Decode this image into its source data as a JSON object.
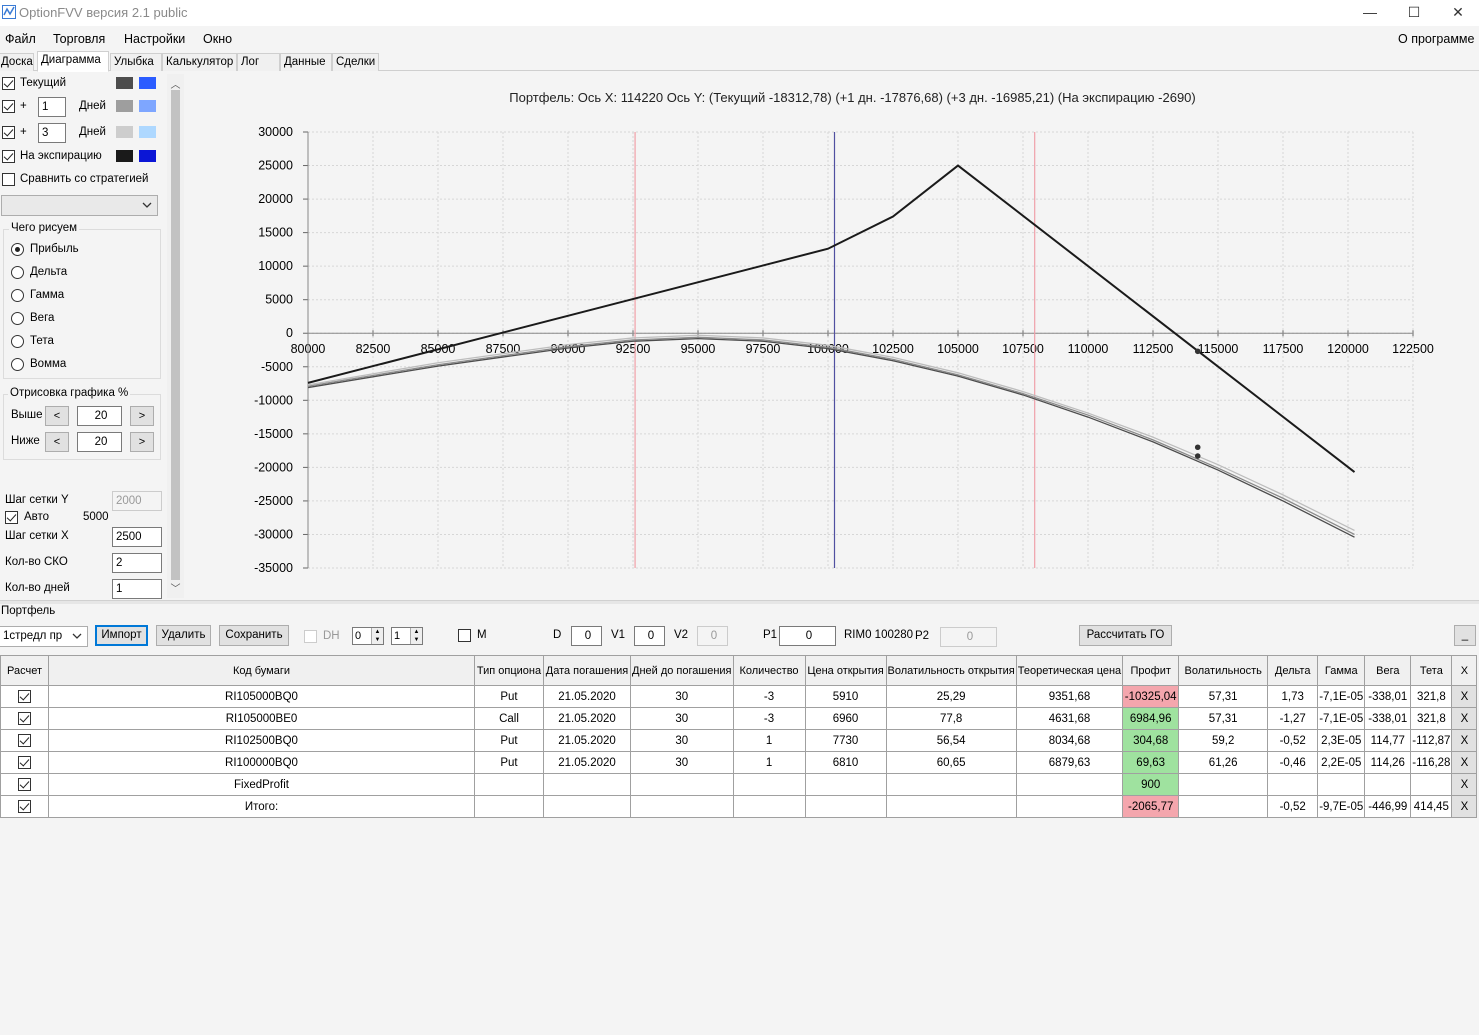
{
  "window": {
    "title": "OptionFVV версия 2.1 public",
    "min": "—",
    "max": "☐",
    "close": "✕"
  },
  "menu": {
    "file": "Файл",
    "trade": "Торговля",
    "settings": "Настройки",
    "window": "Окно",
    "about": "О программе"
  },
  "tabs": [
    "Доска",
    "Диаграмма",
    "Улыбка",
    "Калькулятор",
    "Лог",
    "Данные",
    "Сделки"
  ],
  "left": {
    "current": "Текущий",
    "plus": "+",
    "days1": "1",
    "days3": "3",
    "days_label": "Дней",
    "expiry": "На экспирацию",
    "compare": "Сравнить со стратегией",
    "draw_group": "Чего рисуем",
    "radios": [
      "Прибыль",
      "Дельта",
      "Гамма",
      "Вега",
      "Тета",
      "Вомма"
    ],
    "render_group": "Отрисовка графика %",
    "above": "Выше",
    "below": "Ниже",
    "above_val": "20",
    "below_val": "20",
    "lt": "<",
    "gt": ">",
    "grid_y": "Шаг сетки Y",
    "grid_y_val": "2000",
    "auto": "Авто",
    "auto_val": "5000",
    "grid_x": "Шаг сетки X",
    "grid_x_val": "2500",
    "sko": "Кол-во СКО",
    "sko_val": "2",
    "days_count": "Кол-во дней",
    "days_count_val": "1",
    "colors": {
      "current": [
        "#4d4d4d",
        "#2b5cff"
      ],
      "d1": [
        "#9e9e9e",
        "#7ea6ff"
      ],
      "d3": [
        "#cdcdcd",
        "#aed8ff"
      ],
      "expiry": [
        "#1a1a1a",
        "#0b16d6"
      ]
    }
  },
  "chart_data": {
    "type": "line",
    "title": "Портфель: Ось X: 114220 Ось Y: (Текущий -18312,78) (+1 дн. -17876,68) (+3 дн. -16985,21) (На экспирацию -2690)",
    "xlim": [
      80000,
      122500
    ],
    "ylim": [
      -35000,
      30000
    ],
    "xticks": [
      80000,
      82500,
      85000,
      87500,
      90000,
      92500,
      95000,
      97500,
      100000,
      102500,
      105000,
      107500,
      110000,
      112500,
      115000,
      117500,
      120000,
      122500
    ],
    "yticks": [
      30000,
      25000,
      20000,
      15000,
      10000,
      5000,
      0,
      -5000,
      -10000,
      -15000,
      -20000,
      -25000,
      -30000,
      -35000
    ],
    "vlines": [
      {
        "x": 92580,
        "color": "#f0a0a8"
      },
      {
        "x": 100250,
        "color": "#5050a0"
      },
      {
        "x": 107950,
        "color": "#f0a0a8"
      }
    ],
    "series": [
      {
        "x": [
          80000,
          100000,
          102500,
          105000,
          120250
        ],
        "y": [
          -7400,
          12600,
          17400,
          25000,
          -20700
        ],
        "color": "#1a1a1a",
        "width": 2
      },
      {
        "x": [
          80000,
          85000,
          90000,
          92500,
          95000,
          97500,
          100000,
          102500,
          105000,
          107500,
          110000,
          112500,
          115000,
          117500,
          120250
        ],
        "y": [
          -7700,
          -4400,
          -1700,
          -700,
          -300,
          -700,
          -1800,
          -3600,
          -5900,
          -8700,
          -11900,
          -15500,
          -19600,
          -24100,
          -29400
        ],
        "color": "#bdbdbd",
        "width": 1.3
      },
      {
        "x": [
          80000,
          85000,
          90000,
          92500,
          95000,
          97500,
          100000,
          102500,
          105000,
          107500,
          110000,
          112500,
          115000,
          117500,
          120250
        ],
        "y": [
          -7900,
          -4700,
          -2000,
          -1000,
          -600,
          -1000,
          -2100,
          -3900,
          -6200,
          -9000,
          -12200,
          -15900,
          -20100,
          -24600,
          -30000
        ],
        "color": "#8a8a8a",
        "width": 1.3
      },
      {
        "x": [
          80000,
          85000,
          90000,
          92500,
          95000,
          97500,
          100000,
          102500,
          105000,
          107500,
          110000,
          112500,
          115000,
          117500,
          120250
        ],
        "y": [
          -8100,
          -4900,
          -2200,
          -1200,
          -800,
          -1200,
          -2300,
          -4100,
          -6400,
          -9200,
          -12500,
          -16200,
          -20400,
          -25000,
          -30400
        ],
        "color": "#4d4d4d",
        "width": 1.3
      }
    ],
    "markers": [
      {
        "x": 114220,
        "y": -2690
      },
      {
        "x": 114220,
        "y": -17000
      },
      {
        "x": 114220,
        "y": -18312
      }
    ]
  },
  "portfolio": {
    "label": "Портфель",
    "strategy": "1стредл пр",
    "import": "Импорт",
    "delete": "Удалить",
    "save": "Сохранить",
    "dh": "DH",
    "spin1": "0",
    "spin2": "1",
    "m": "M",
    "d": "D",
    "d_val": "0",
    "v1": "V1",
    "v1_val": "0",
    "v2": "V2",
    "v2_val": "0",
    "p1": "P1",
    "p1_val": "0",
    "rim": "RIM0 100280",
    "p2": "P2",
    "p2_val": "0",
    "calc_go": "Рассчитать ГО",
    "collapse": "_"
  },
  "table": {
    "headers": [
      "Расчет",
      "Код бумаги",
      "Тип опциона",
      "Дата погашения",
      "Дней до погашения",
      "Количество",
      "Цена открытия",
      "Волатильность открытия",
      "Теоретическая цена",
      "Профит",
      "Волатильность",
      "Дельта",
      "Гамма",
      "Вега",
      "Тета",
      "X"
    ],
    "rows": [
      [
        "RI105000BQ0",
        "Put",
        "21.05.2020",
        "30",
        "-3",
        "5910",
        "25,29",
        "9351,68",
        "-10325,04",
        "57,31",
        "1,73",
        "-7,1E-05",
        "-338,01",
        "321,8",
        "X"
      ],
      [
        "RI105000BE0",
        "Call",
        "21.05.2020",
        "30",
        "-3",
        "6960",
        "77,8",
        "4631,68",
        "6984,96",
        "57,31",
        "-1,27",
        "-7,1E-05",
        "-338,01",
        "321,8",
        "X"
      ],
      [
        "RI102500BQ0",
        "Put",
        "21.05.2020",
        "30",
        "1",
        "7730",
        "56,54",
        "8034,68",
        "304,68",
        "59,2",
        "-0,52",
        "2,3E-05",
        "114,77",
        "-112,87",
        "X"
      ],
      [
        "RI100000BQ0",
        "Put",
        "21.05.2020",
        "30",
        "1",
        "6810",
        "60,65",
        "6879,63",
        "69,63",
        "61,26",
        "-0,46",
        "2,2E-05",
        "114,26",
        "-116,28",
        "X"
      ],
      [
        "FixedProfit",
        "",
        "",
        "",
        "",
        "",
        "",
        "",
        "900",
        "",
        "",
        "",
        "",
        "",
        "X"
      ],
      [
        "Итого:",
        "",
        "",
        "",
        "",
        "",
        "",
        "",
        "-2065,77",
        "",
        "-0,52",
        "-9,7E-05",
        "-446,99",
        "414,45",
        "X"
      ]
    ],
    "profit_class": [
      "red",
      "green",
      "green",
      "green",
      "green",
      "red"
    ]
  }
}
